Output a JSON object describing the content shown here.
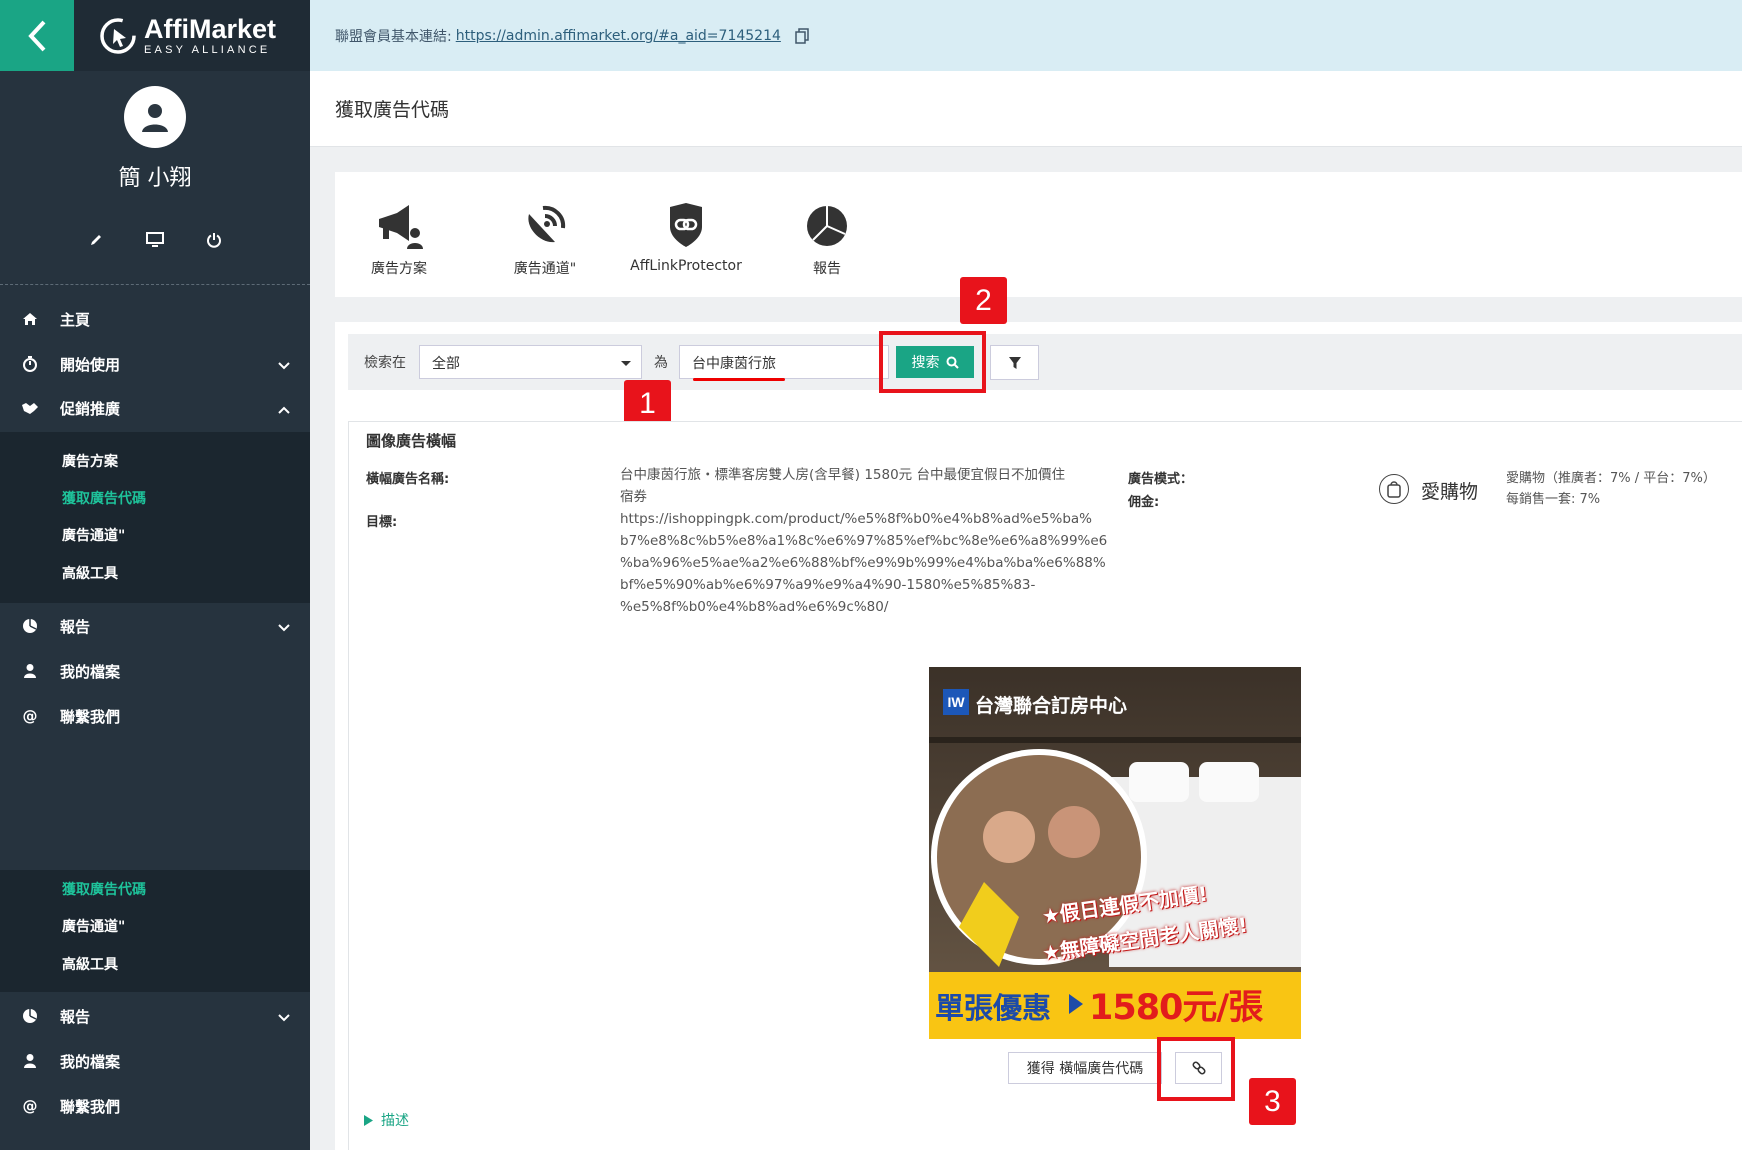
{
  "brand": {
    "name": "AffiMarket",
    "tagline": "EASY ALLIANCE"
  },
  "user": {
    "name": "簡 小翔"
  },
  "sidebar": {
    "nav": [
      {
        "label": "主頁",
        "icon": "home-icon"
      },
      {
        "label": "開始使用",
        "icon": "stopwatch-icon"
      },
      {
        "label": "促銷推廣",
        "icon": "promo-icon"
      }
    ],
    "promo_sub": [
      "廣告方案",
      "獲取廣告代碼",
      "廣告通道\"",
      "高級工具"
    ],
    "nav2": [
      {
        "label": "報告",
        "icon": "pie-icon"
      },
      {
        "label": "我的檔案",
        "icon": "user-icon"
      },
      {
        "label": "聯繫我們",
        "icon": "at-icon"
      }
    ],
    "dup_sub": [
      "獲取廣告代碼",
      "廣告通道\"",
      "高級工具"
    ],
    "nav3": [
      {
        "label": "報告",
        "icon": "pie-icon"
      },
      {
        "label": "我的檔案",
        "icon": "user-icon"
      },
      {
        "label": "聯繫我們",
        "icon": "at-icon"
      }
    ]
  },
  "topbar": {
    "label": "聯盟會員基本連結:",
    "link": "https://admin.affimarket.org/#a_aid=7145214"
  },
  "page": {
    "title": "獲取廣告代碼"
  },
  "tools": [
    "廣告方案",
    "廣告通道\"",
    "AffLinkProtector",
    "報告"
  ],
  "search": {
    "in_label": "檢索在",
    "scope_value": "全部",
    "for_label": "為",
    "query": "台中康茵行旅",
    "button": "搜索"
  },
  "callouts": [
    "1",
    "2",
    "3"
  ],
  "ad": {
    "section_title": "圖像廣告橫幅",
    "name_label": "橫幅廣告名稱:",
    "name_value_1": "台中康茵行旅・標準客房雙人房(含早餐) 1580元 台中最便宜假日不加價住",
    "name_value_2": "宿券",
    "target_label": "目標:",
    "target_lines": [
      "https://ishoppingpk.com/product/%e5%8f%b0%e4%b8%ad%e5%ba%",
      "b7%e8%8c%b5%e8%a1%8c%e6%97%85%ef%bc%8e%e6%a8%99%e6",
      "%ba%96%e5%ae%a2%e6%88%bf%e9%9b%99%e4%ba%ba%e6%88%",
      "bf%e5%90%ab%e6%97%a9%e9%a4%90-1580%e5%85%83-",
      "%e5%8f%b0%e4%b8%ad%e6%9c%80/"
    ],
    "mode_label": "廣告模式：",
    "commission_label": "佣金:",
    "shop_name": "愛購物",
    "commission_line1": "愛購物（推廣者：7% / 平台：7%）",
    "commission_line2": "每銷售一套: 7%",
    "banner": {
      "logo": "IW",
      "header": "台灣聯合訂房中心",
      "slogan1": "★假日連假不加價!",
      "slogan2": "★無障礙空間老人關懷!",
      "offer_left": "單張優惠",
      "offer_price": "1580元/張"
    },
    "get_code_button": "獲得 橫幅廣告代碼",
    "description_toggle": "描述"
  },
  "colors": {
    "accent": "#1aa585",
    "sidebar": "#26333e",
    "callout": "#e8131b",
    "active_sub": "#1ec29a"
  }
}
